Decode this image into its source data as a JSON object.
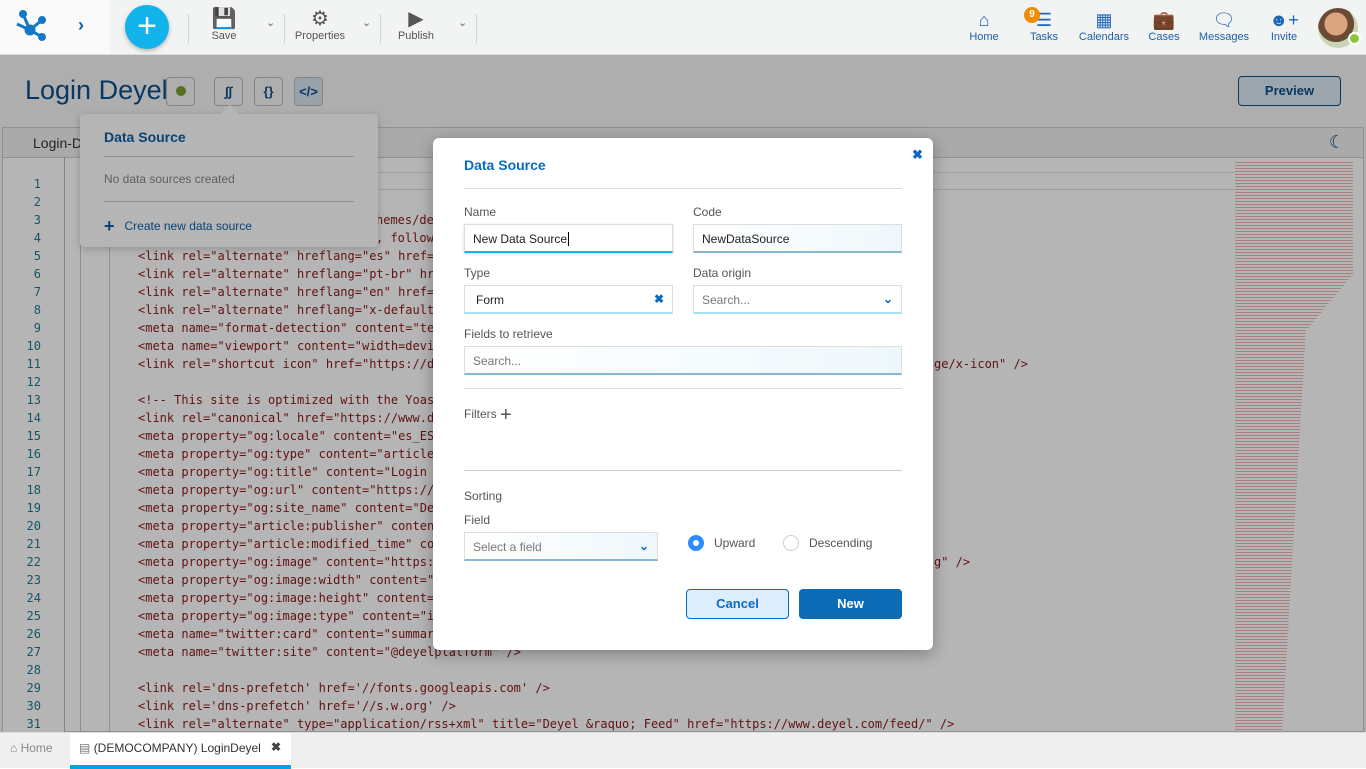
{
  "topbar": {
    "tools": [
      {
        "label": "Save",
        "icon": "save-icon"
      },
      {
        "label": "Properties",
        "icon": "gear-icon"
      },
      {
        "label": "Publish",
        "icon": "play-icon"
      }
    ],
    "nav": [
      {
        "label": "Home",
        "icon": "home-icon"
      },
      {
        "label": "Tasks",
        "icon": "tasks-icon"
      },
      {
        "label": "Calendars",
        "icon": "calendar-icon"
      },
      {
        "label": "Cases",
        "icon": "briefcase-icon"
      },
      {
        "label": "Messages",
        "icon": "message-icon"
      },
      {
        "label": "Invite",
        "icon": "add-user-icon"
      }
    ],
    "tasks_badge": "9",
    "user_status_color": "#8cc63f"
  },
  "page": {
    "title": "Login Deyel",
    "preview_label": "Preview",
    "status_color": "#7aa02c",
    "editor_tab": "Login-D"
  },
  "popover": {
    "title": "Data Source",
    "empty": "No data sources created",
    "create": "Create new data source"
  },
  "code": [
    {
      "n": "1",
      "t": ""
    },
    {
      "n": "2",
      "t": ""
    },
    {
      "n": "3",
      "t": "hemes/de",
      "off": true
    },
    {
      "n": "4",
      "t": ", follow",
      "off": true
    },
    {
      "n": "5",
      "t": "<link rel=\"alternate\" hreflang=\"es\" href='"
    },
    {
      "n": "6",
      "t": "<link rel=\"alternate\" hreflang=\"pt-br\" hre"
    },
    {
      "n": "7",
      "t": "<link rel=\"alternate\" hreflang=\"en\" href='"
    },
    {
      "n": "8",
      "t": "<link rel=\"alternate\" hreflang=\"x-default'"
    },
    {
      "n": "9",
      "t": "<meta name=\"format-detection\" content=\"tel"
    },
    {
      "n": "10",
      "t": "<meta name=\"viewport\" content=\"width=devic"
    },
    {
      "n": "11",
      "t": "<link rel=\"shortcut icon\" href=\"https://de",
      "r": "ge/x-icon\" />"
    },
    {
      "n": "12",
      "t": ""
    },
    {
      "n": "13",
      "t": "<!-- This site is optimized with the Yoast"
    },
    {
      "n": "14",
      "t": "<link rel=\"canonical\" href=\"https://www.de"
    },
    {
      "n": "15",
      "t": "<meta property=\"og:locale\" content=\"es_ES'"
    },
    {
      "n": "16",
      "t": "<meta property=\"og:type\" content=\"article'"
    },
    {
      "n": "17",
      "t": "<meta property=\"og:title\" content=\"Login i"
    },
    {
      "n": "18",
      "t": "<meta property=\"og:url\" content=\"https://w"
    },
    {
      "n": "19",
      "t": "<meta property=\"og:site_name\" content=\"Dey"
    },
    {
      "n": "20",
      "t": "<meta property=\"article:publisher\" content"
    },
    {
      "n": "21",
      "t": "<meta property=\"article:modified_time\" con"
    },
    {
      "n": "22",
      "t": "<meta property=\"og:image\" content=\"https:/",
      "r": "g\" />"
    },
    {
      "n": "23",
      "t": "<meta property=\"og:image:width\" content=\"8"
    },
    {
      "n": "24",
      "t": "<meta property=\"og:image:height\" content='"
    },
    {
      "n": "25",
      "t": "<meta property=\"og:image:type\" content=\"im"
    },
    {
      "n": "26",
      "t": "<meta name=\"twitter:card\" content=\"summary"
    },
    {
      "n": "27",
      "t": "<meta name=\"twitter:site\" content=\"@deyelplatform\" />"
    },
    {
      "n": "28",
      "t": ""
    },
    {
      "n": "29",
      "t": "<link rel='dns-prefetch' href='//fonts.googleapis.com' />"
    },
    {
      "n": "30",
      "t": "<link rel='dns-prefetch' href='//s.w.org' />"
    },
    {
      "n": "31",
      "t": "<link rel=\"alternate\" type=\"application/rss+xml\" title=\"Deyel &raquo; Feed\" href=\"https://www.deyel.com/feed/\" />"
    }
  ],
  "modal": {
    "title": "Data Source",
    "name_label": "Name",
    "name_value": "New Data Source",
    "code_label": "Code",
    "code_value": "NewDataSource",
    "type_label": "Type",
    "type_value": "Form",
    "origin_label": "Data origin",
    "origin_placeholder": "Search...",
    "fields_label": "Fields to retrieve",
    "fields_placeholder": "Search...",
    "filters_label": "Filters",
    "sorting_label": "Sorting",
    "field_label": "Field",
    "field_placeholder": "Select a field",
    "upward": "Upward",
    "descending": "Descending",
    "selected_order": "Upward",
    "cancel": "Cancel",
    "new": "New"
  },
  "bottom": {
    "home": "Home",
    "tab": "(DEMOCOMPANY) LoginDeyel"
  }
}
